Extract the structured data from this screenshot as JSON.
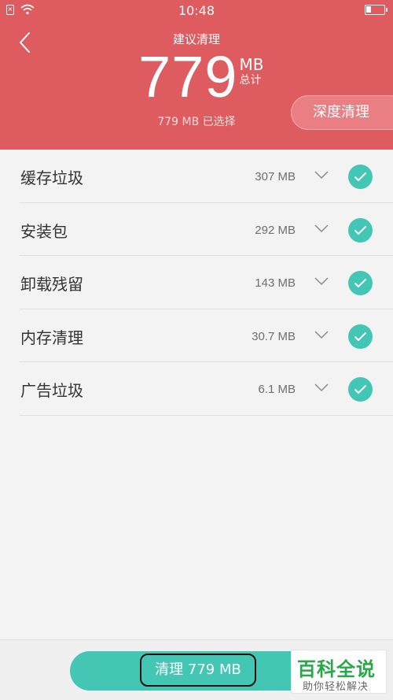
{
  "status_bar": {
    "time": "10:48",
    "sim_glyph": "×"
  },
  "header": {
    "title": "建议清理",
    "total_size": "779",
    "total_unit": "MB",
    "total_label": "总计",
    "selected_text": "779 MB 已选择",
    "deep_clean_label": "深度清理",
    "background_color": "#de5b5f"
  },
  "items": [
    {
      "label": "缓存垃圾",
      "size": "307 MB",
      "checked": true
    },
    {
      "label": "安装包",
      "size": "292 MB",
      "checked": true
    },
    {
      "label": "卸载残留",
      "size": "143 MB",
      "checked": true
    },
    {
      "label": "内存清理",
      "size": "30.7 MB",
      "checked": true
    },
    {
      "label": "广告垃圾",
      "size": "6.1 MB",
      "checked": true
    }
  ],
  "bottom": {
    "clean_label": "清理 779 MB",
    "accent_color": "#43c7b4"
  },
  "watermark": {
    "title": "百科全说",
    "subtitle": "助你轻松解决"
  },
  "icons": [
    "back-icon",
    "wifi-icon",
    "battery-icon",
    "chevron-down-icon",
    "check-icon"
  ]
}
